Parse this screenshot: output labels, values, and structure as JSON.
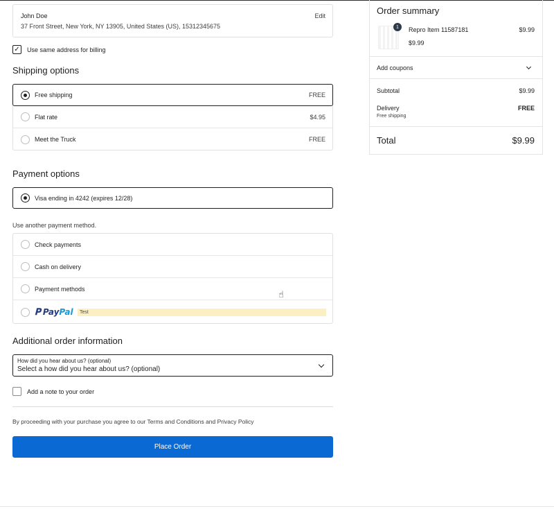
{
  "address": {
    "name": "John Doe",
    "line": "37 Front Street, New York, NY 13905, United States (US), 15312345675",
    "edit_label": "Edit"
  },
  "billing": {
    "same_address_label": "Use same address for billing",
    "checked": true
  },
  "shipping": {
    "title": "Shipping options",
    "options": [
      {
        "label": "Free shipping",
        "price": "FREE",
        "selected": true
      },
      {
        "label": "Flat rate",
        "price": "$4.95",
        "selected": false
      },
      {
        "label": "Meet the Truck",
        "price": "FREE",
        "selected": false
      }
    ]
  },
  "payment": {
    "title": "Payment options",
    "saved_card": "Visa ending in 4242 (expires 12/28)",
    "other_label": "Use another payment method.",
    "methods": [
      {
        "label": "Check payments"
      },
      {
        "label": "Cash on delivery"
      },
      {
        "label": "Payment methods"
      }
    ],
    "paypal": {
      "logo_pay": "Pay",
      "logo_pal": "Pal",
      "badge": "Test"
    }
  },
  "additional": {
    "title": "Additional order information",
    "select_label": "How did you hear about us? (optional)",
    "select_value": "Select a how did you hear about us? (optional)",
    "note_label": "Add a note to your order"
  },
  "terms": "By proceeding with your purchase you agree to our Terms and Conditions and Privacy Policy",
  "place_order_label": "Place Order",
  "summary": {
    "title": "Order summary",
    "item": {
      "qty": "1",
      "name": "Repro Item 11587181",
      "price": "$9.99",
      "unit_price": "$9.99"
    },
    "coupons_label": "Add coupons",
    "subtotal_label": "Subtotal",
    "subtotal_value": "$9.99",
    "delivery_label": "Delivery",
    "delivery_value": "FREE",
    "delivery_note": "Free shipping",
    "total_label": "Total",
    "total_value": "$9.99"
  },
  "colors": {
    "primary_button": "#0b69d3",
    "paypal_dark": "#253b80",
    "paypal_light": "#179bd7",
    "test_badge_bg": "#fdefc4"
  }
}
